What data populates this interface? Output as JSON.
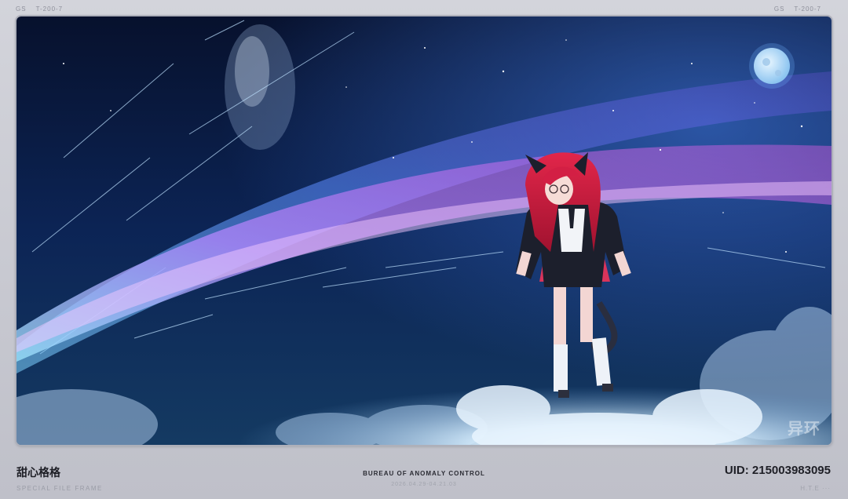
{
  "header": {
    "left_codes": [
      "GS",
      "T-200-7"
    ],
    "right_codes": [
      "GS",
      "T-200-7"
    ]
  },
  "scene": {
    "watermark": "异环",
    "colors": {
      "sky_dark": "#06102a",
      "comet_pink": "#d45be0",
      "comet_cyan": "#6fd0ff",
      "glow": "#cfe9ff"
    }
  },
  "footer": {
    "name": "甜心格格",
    "subtitle": "SPECIAL FILE FRAME",
    "center_title": "BUREAU OF ANOMALY CONTROL",
    "center_date": "2026.04.29-04.21.03",
    "uid": "UID: 215003983095",
    "uid_sub": "H.T.E ···"
  }
}
